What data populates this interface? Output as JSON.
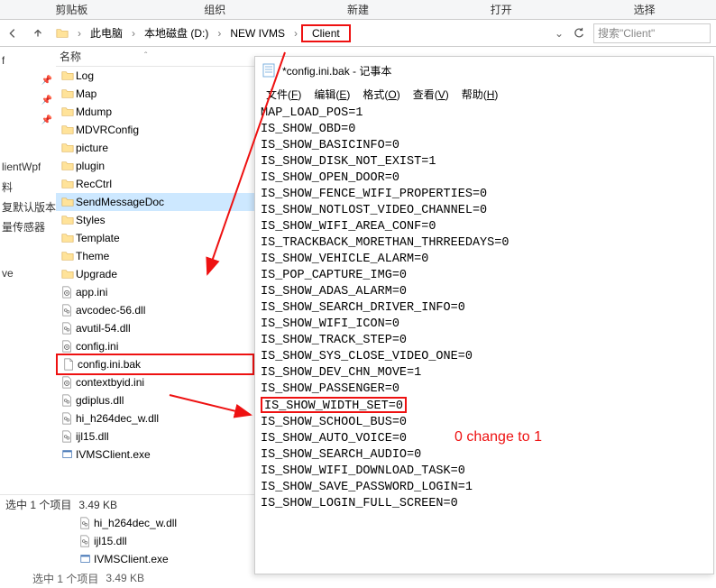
{
  "ribbon": {
    "tabs": [
      "剪贴板",
      "组织",
      "新建",
      "打开",
      "选择"
    ]
  },
  "breadcrumb": {
    "items": [
      "此电脑",
      "本地磁盘 (D:)",
      "NEW IVMS",
      "Client"
    ],
    "search_placeholder": "搜索\"Client\""
  },
  "sidebar": {
    "items": [
      "f",
      "",
      "",
      "",
      "lientWpf",
      "料",
      "复默认版本",
      "量传感器",
      "",
      "ve",
      ""
    ]
  },
  "filelist": {
    "header": "名称",
    "items": [
      {
        "name": "Log",
        "type": "folder"
      },
      {
        "name": "Map",
        "type": "folder"
      },
      {
        "name": "Mdump",
        "type": "folder"
      },
      {
        "name": "MDVRConfig",
        "type": "folder"
      },
      {
        "name": "picture",
        "type": "folder"
      },
      {
        "name": "plugin",
        "type": "folder"
      },
      {
        "name": "RecCtrl",
        "type": "folder"
      },
      {
        "name": "SendMessageDoc",
        "type": "folder",
        "sel": true
      },
      {
        "name": "Styles",
        "type": "folder"
      },
      {
        "name": "Template",
        "type": "folder"
      },
      {
        "name": "Theme",
        "type": "folder"
      },
      {
        "name": "Upgrade",
        "type": "folder"
      },
      {
        "name": "app.ini",
        "type": "ini"
      },
      {
        "name": "avcodec-56.dll",
        "type": "dll"
      },
      {
        "name": "avutil-54.dll",
        "type": "dll"
      },
      {
        "name": "config.ini",
        "type": "ini"
      },
      {
        "name": "config.ini.bak",
        "type": "bak",
        "hl": true
      },
      {
        "name": "contextbyid.ini",
        "type": "ini"
      },
      {
        "name": "gdiplus.dll",
        "type": "dll"
      },
      {
        "name": "hi_h264dec_w.dll",
        "type": "dll"
      },
      {
        "name": "ijl15.dll",
        "type": "dll"
      },
      {
        "name": "IVMSClient.exe",
        "type": "exe"
      }
    ],
    "extra_rows": [
      {
        "name": "hi_h264dec_w.dll",
        "type": "dll"
      },
      {
        "name": "ijl15.dll",
        "type": "dll"
      },
      {
        "name": "IVMSClient.exe",
        "type": "exe"
      }
    ]
  },
  "status": {
    "text1": "选中 1 个项目",
    "text2": "3.49 KB",
    "text1_dup": "选中 1 个项目",
    "text2_dup": "3.49 KB"
  },
  "notepad": {
    "title": "*config.ini.bak - 记事本",
    "menu_html": [
      "文件(<u>F</u>)",
      "编辑(<u>E</u>)",
      "格式(<u>O</u>)",
      "查看(<u>V</u>)",
      "帮助(<u>H</u>)"
    ],
    "lines": [
      "MAP_LOAD_POS=1",
      "IS_SHOW_OBD=0",
      "IS_SHOW_BASICINFO=0",
      "IS_SHOW_DISK_NOT_EXIST=1",
      "IS_SHOW_OPEN_DOOR=0",
      "IS_SHOW_FENCE_WIFI_PROPERTIES=0",
      "IS_SHOW_NOTLOST_VIDEO_CHANNEL=0",
      "IS_SHOW_WIFI_AREA_CONF=0",
      "IS_TRACKBACK_MORETHAN_THRREEDAYS=0",
      "IS_SHOW_VEHICLE_ALARM=0",
      "IS_POP_CAPTURE_IMG=0",
      "IS_SHOW_ADAS_ALARM=0",
      "IS_SHOW_SEARCH_DRIVER_INFO=0",
      "IS_SHOW_WIFI_ICON=0",
      "IS_SHOW_TRACK_STEP=0",
      "IS_SHOW_SYS_CLOSE_VIDEO_ONE=0",
      "IS_SHOW_DEV_CHN_MOVE=1",
      "IS_SHOW_PASSENGER=0",
      "IS_SHOW_WIDTH_SET=0",
      "IS_SHOW_SCHOOL_BUS=0",
      "IS_SHOW_AUTO_VOICE=0",
      "IS_SHOW_SEARCH_AUDIO=0",
      "IS_SHOW_WIFI_DOWNLOAD_TASK=0",
      "IS_SHOW_SAVE_PASSWORD_LOGIN=1",
      "IS_SHOW_LOGIN_FULL_SCREEN=0"
    ],
    "highlight_line_index": 18
  },
  "annotation": {
    "text": "0 change to 1"
  }
}
